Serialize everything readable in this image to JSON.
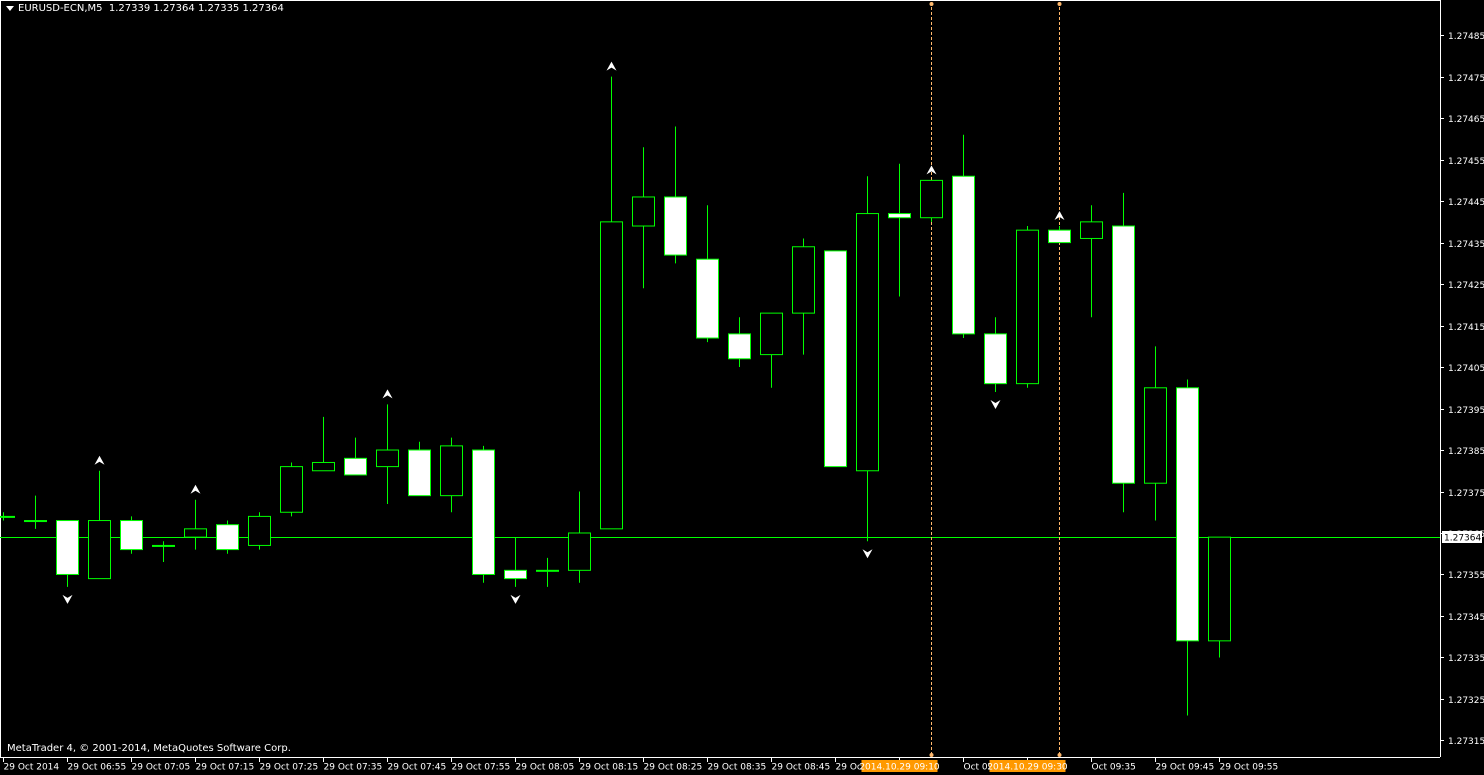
{
  "header": {
    "symbol": "EURUSD-ECN,M5",
    "ohlc": "1.27339 1.27364 1.27335 1.27364"
  },
  "footer": {
    "copyright": "MetaTrader 4, © 2001-2014, MetaQuotes Software Corp."
  },
  "colors": {
    "background": "#000000",
    "foreground": "#FFFFFF",
    "candle_outline": "#00FF00",
    "bull_body": "#000000",
    "bear_body": "#FFFFFF",
    "vline": "#FFB86C",
    "time_marker_bg": "#FF9900"
  },
  "chart_data": {
    "type": "candlestick",
    "timeframe": "M5",
    "ylim": [
      1.27311,
      1.27493
    ],
    "y_ticks": [
      "1.27485",
      "1.27475",
      "1.27465",
      "1.27455",
      "1.27445",
      "1.27435",
      "1.27425",
      "1.27415",
      "1.27405",
      "1.27395",
      "1.27385",
      "1.27375",
      "1.27365",
      "1.27355",
      "1.27345",
      "1.27335",
      "1.27325",
      "1.27315"
    ],
    "current_price": "1.27364",
    "x_ticks": [
      "29 Oct 2014",
      "29 Oct 06:55",
      "29 Oct 07:05",
      "29 Oct 07:15",
      "29 Oct 07:25",
      "29 Oct 07:35",
      "29 Oct 07:45",
      "29 Oct 07:55",
      "29 Oct 08:05",
      "29 Oct 08:15",
      "29 Oct 08:25",
      "29 Oct 08:35",
      "29 Oct 08:45",
      "29 Oct 08:55",
      "2014.10.29 09:10",
      "Oct 09:15",
      "2014.10.29 09:30",
      "Oct 09:35",
      "29 Oct 09:45",
      "29 Oct 09:55"
    ],
    "highlighted_times": [
      "2014.10.29 09:10",
      "2014.10.29 09:30"
    ],
    "candles": [
      {
        "time": "06:45",
        "o": 1.27369,
        "h": 1.2737,
        "l": 1.27368,
        "c": 1.27369
      },
      {
        "time": "06:50",
        "o": 1.27368,
        "h": 1.27374,
        "l": 1.27366,
        "c": 1.27368
      },
      {
        "time": "06:55",
        "o": 1.27368,
        "h": 1.27368,
        "l": 1.27352,
        "c": 1.27355
      },
      {
        "time": "07:00",
        "o": 1.27354,
        "h": 1.2738,
        "l": 1.27354,
        "c": 1.27368
      },
      {
        "time": "07:05",
        "o": 1.27368,
        "h": 1.27369,
        "l": 1.2736,
        "c": 1.27361
      },
      {
        "time": "07:10",
        "o": 1.27362,
        "h": 1.27363,
        "l": 1.27358,
        "c": 1.27362
      },
      {
        "time": "07:15",
        "o": 1.27364,
        "h": 1.27373,
        "l": 1.27361,
        "c": 1.27366
      },
      {
        "time": "07:20",
        "o": 1.27367,
        "h": 1.27368,
        "l": 1.2736,
        "c": 1.27361
      },
      {
        "time": "07:25",
        "o": 1.27362,
        "h": 1.2737,
        "l": 1.27361,
        "c": 1.27369
      },
      {
        "time": "07:30",
        "o": 1.2737,
        "h": 1.27382,
        "l": 1.27369,
        "c": 1.27381
      },
      {
        "time": "07:35",
        "o": 1.2738,
        "h": 1.27393,
        "l": 1.2738,
        "c": 1.27382
      },
      {
        "time": "07:40",
        "o": 1.27383,
        "h": 1.27388,
        "l": 1.27379,
        "c": 1.27379
      },
      {
        "time": "07:45",
        "o": 1.27381,
        "h": 1.27396,
        "l": 1.27372,
        "c": 1.27385
      },
      {
        "time": "07:50",
        "o": 1.27385,
        "h": 1.27387,
        "l": 1.27374,
        "c": 1.27374
      },
      {
        "time": "07:55",
        "o": 1.27374,
        "h": 1.27388,
        "l": 1.2737,
        "c": 1.27386
      },
      {
        "time": "08:00",
        "o": 1.27385,
        "h": 1.27386,
        "l": 1.27353,
        "c": 1.27355
      },
      {
        "time": "08:05",
        "o": 1.27356,
        "h": 1.27364,
        "l": 1.27352,
        "c": 1.27354
      },
      {
        "time": "08:10",
        "o": 1.27356,
        "h": 1.27359,
        "l": 1.27352,
        "c": 1.27356
      },
      {
        "time": "08:15",
        "o": 1.27356,
        "h": 1.27375,
        "l": 1.27353,
        "c": 1.27365
      },
      {
        "time": "08:20",
        "o": 1.27366,
        "h": 1.27475,
        "l": 1.27366,
        "c": 1.2744
      },
      {
        "time": "08:25",
        "o": 1.27439,
        "h": 1.27458,
        "l": 1.27424,
        "c": 1.27446
      },
      {
        "time": "08:30",
        "o": 1.27446,
        "h": 1.27463,
        "l": 1.2743,
        "c": 1.27432
      },
      {
        "time": "08:35",
        "o": 1.27431,
        "h": 1.27444,
        "l": 1.27411,
        "c": 1.27412
      },
      {
        "time": "08:40",
        "o": 1.27413,
        "h": 1.27417,
        "l": 1.27405,
        "c": 1.27407
      },
      {
        "time": "08:45",
        "o": 1.27408,
        "h": 1.27418,
        "l": 1.274,
        "c": 1.27418
      },
      {
        "time": "08:50",
        "o": 1.27418,
        "h": 1.27436,
        "l": 1.27408,
        "c": 1.27434
      },
      {
        "time": "08:55",
        "o": 1.27433,
        "h": 1.27433,
        "l": 1.27381,
        "c": 1.27381
      },
      {
        "time": "09:00",
        "o": 1.2738,
        "h": 1.27451,
        "l": 1.27363,
        "c": 1.27442
      },
      {
        "time": "09:05",
        "o": 1.27442,
        "h": 1.27454,
        "l": 1.27422,
        "c": 1.27441
      },
      {
        "time": "09:10",
        "o": 1.27441,
        "h": 1.2745,
        "l": 1.2744,
        "c": 1.2745
      },
      {
        "time": "09:15",
        "o": 1.27451,
        "h": 1.27461,
        "l": 1.27412,
        "c": 1.27413
      },
      {
        "time": "09:20",
        "o": 1.27413,
        "h": 1.27417,
        "l": 1.27399,
        "c": 1.27401
      },
      {
        "time": "09:25",
        "o": 1.27401,
        "h": 1.27439,
        "l": 1.274,
        "c": 1.27438
      },
      {
        "time": "09:30",
        "o": 1.27438,
        "h": 1.27439,
        "l": 1.27435,
        "c": 1.27435
      },
      {
        "time": "09:35",
        "o": 1.27436,
        "h": 1.27444,
        "l": 1.27417,
        "c": 1.2744
      },
      {
        "time": "09:40",
        "o": 1.27439,
        "h": 1.27447,
        "l": 1.2737,
        "c": 1.27377
      },
      {
        "time": "09:45",
        "o": 1.27377,
        "h": 1.2741,
        "l": 1.27368,
        "c": 1.274
      },
      {
        "time": "09:50",
        "o": 1.274,
        "h": 1.27402,
        "l": 1.27321,
        "c": 1.27339
      },
      {
        "time": "09:55",
        "o": 1.27339,
        "h": 1.27364,
        "l": 1.27335,
        "c": 1.27364
      }
    ],
    "fractals": [
      {
        "index": 2,
        "dir": "down"
      },
      {
        "index": 3,
        "dir": "up"
      },
      {
        "index": 6,
        "dir": "up"
      },
      {
        "index": 12,
        "dir": "up"
      },
      {
        "index": 16,
        "dir": "down"
      },
      {
        "index": 19,
        "dir": "up"
      },
      {
        "index": 27,
        "dir": "down"
      },
      {
        "index": 29,
        "dir": "up"
      },
      {
        "index": 31,
        "dir": "down"
      },
      {
        "index": 33,
        "dir": "up"
      }
    ],
    "vlines_at_index": [
      29,
      33
    ]
  }
}
